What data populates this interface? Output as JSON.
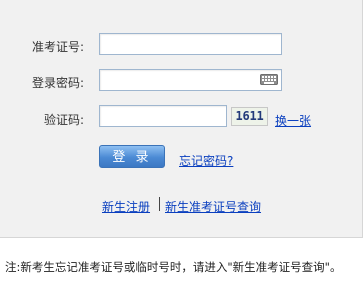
{
  "form": {
    "exam_id_label": "准考证号:",
    "exam_id_value": "",
    "password_label": "登录密码:",
    "password_value": "",
    "captcha_label": "验证码:",
    "captcha_value": "",
    "captcha_image_text": "1611",
    "refresh_captcha_link": "换一张",
    "login_button": "登 录",
    "forgot_password_link": "忘记密码?"
  },
  "links": {
    "register": "新生注册",
    "query_exam_id": "新生准考证号查询"
  },
  "note": "注:新考生忘记准考证号或临时号时，请进入\"新生准考证号查询\"。",
  "icons": {
    "keyboard": "keyboard-icon"
  }
}
